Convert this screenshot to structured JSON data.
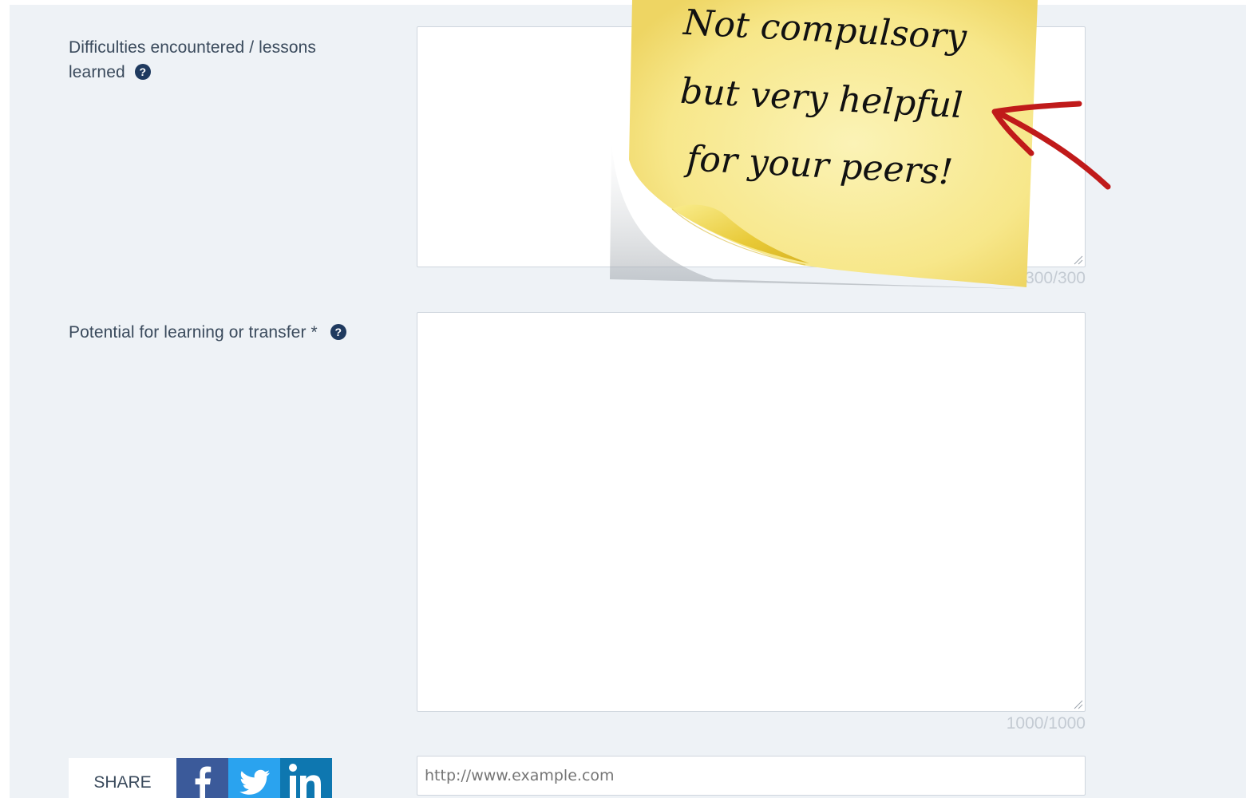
{
  "form": {
    "difficulties": {
      "label_line1": "Difficulties encountered / lessons",
      "label_line2": "learned",
      "counter": "300/300"
    },
    "potential": {
      "label": "Potential for learning or transfer *",
      "counter": "1000/1000"
    },
    "url": {
      "placeholder": "http://www.example.com"
    },
    "help_glyph": "?"
  },
  "share": {
    "label": "SHARE",
    "buttons": [
      {
        "name": "facebook",
        "icon": "facebook-icon",
        "color": "#3b5a9a"
      },
      {
        "name": "twitter",
        "icon": "twitter-icon",
        "color": "#2aa3ef"
      },
      {
        "name": "linkedin",
        "icon": "linkedin-icon",
        "color": "#0e77b0"
      }
    ]
  },
  "annotation": {
    "line1": "Not compulsory",
    "line2": "but very helpful",
    "line3": "for your peers!",
    "note_color": "#f7e78a",
    "arrow_color": "#c01a1a"
  }
}
